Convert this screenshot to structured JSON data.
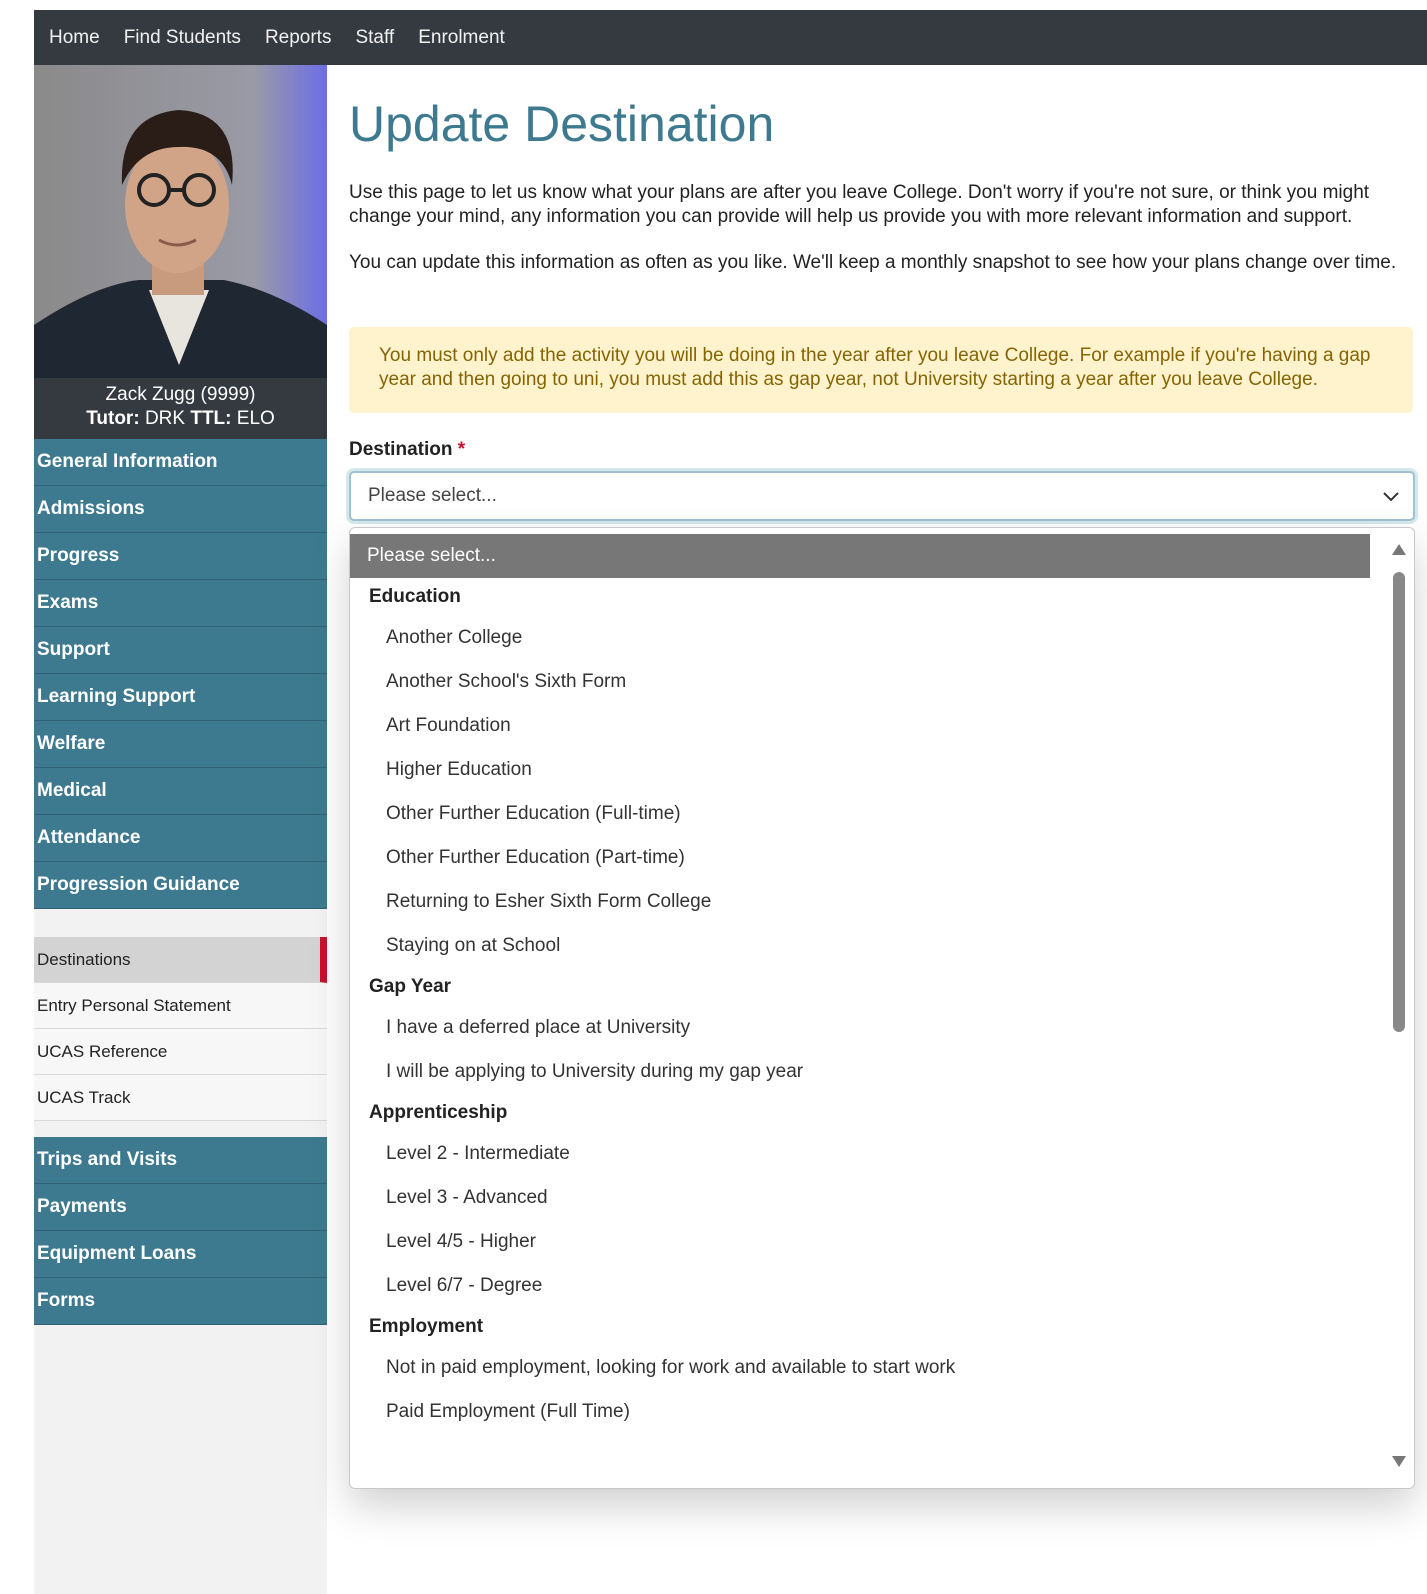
{
  "topnav": {
    "items": [
      "Home",
      "Find Students",
      "Reports",
      "Staff",
      "Enrolment"
    ]
  },
  "student": {
    "name": "Zack Zugg (9999)",
    "tutor_label": "Tutor:",
    "tutor_value": "DRK",
    "ttl_label": "TTL:",
    "ttl_value": "ELO"
  },
  "sidebar": {
    "main_items": [
      "General Information",
      "Admissions",
      "Progress",
      "Exams",
      "Support",
      "Learning Support",
      "Welfare",
      "Medical",
      "Attendance",
      "Progression Guidance"
    ],
    "sub_items": [
      "Destinations",
      "Entry Personal Statement",
      "UCAS Reference",
      "UCAS Track"
    ],
    "active_sub": "Destinations",
    "bottom_items": [
      "Trips and Visits",
      "Payments",
      "Equipment Loans",
      "Forms"
    ]
  },
  "page": {
    "title": "Update Destination",
    "intro_1": "Use this page to let us know what your plans are after you leave College. Don't worry if you're not sure, or think you might change your mind, any information you can provide will help us provide you with more relevant information and support.",
    "intro_2": "You can update this information as often as you like. We'll keep a monthly snapshot to see how your plans change over time.",
    "warning": "You must only add the activity you will be doing in the year after you leave College. For example if you're having a gap year and then going to uni, you must add this as gap year, not University starting a year after you leave College."
  },
  "form": {
    "destination_label": "Destination",
    "required_mark": "*",
    "select_value": "Please select..."
  },
  "dropdown": {
    "selected": "Please select...",
    "groups": [
      {
        "label": "Education",
        "options": [
          "Another College",
          "Another School's Sixth Form",
          "Art Foundation",
          "Higher Education",
          "Other Further Education (Full-time)",
          "Other Further Education (Part-time)",
          "Returning to Esher Sixth Form College",
          "Staying on at School"
        ]
      },
      {
        "label": "Gap Year",
        "options": [
          "I have a deferred place at University",
          "I will be applying to University during my gap year"
        ]
      },
      {
        "label": "Apprenticeship",
        "options": [
          "Level 2 - Intermediate",
          "Level 3 - Advanced",
          "Level 4/5 - Higher",
          "Level 6/7 - Degree"
        ]
      },
      {
        "label": "Employment",
        "options": [
          "Not in paid employment, looking for work and available to start work",
          "Paid Employment (Full Time)"
        ]
      }
    ]
  },
  "colors": {
    "nav_bg": "#343a40",
    "menu_bg": "#3e7a8f",
    "title": "#3e7a8f",
    "warning_bg": "#fff3cd",
    "warning_text": "#856404",
    "active_marker": "#c8102e"
  },
  "icons": {
    "select": "chevron-down-icon",
    "scroll_up": "triangle-up-icon",
    "scroll_down": "triangle-down-icon"
  }
}
